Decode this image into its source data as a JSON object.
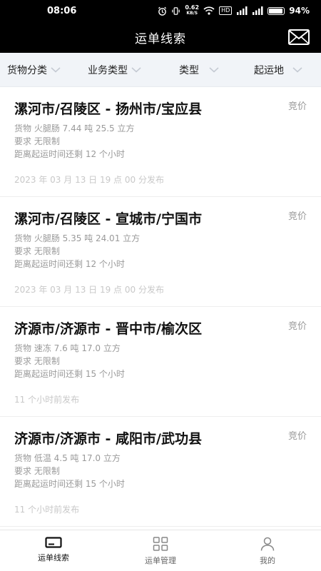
{
  "status_bar": {
    "time": "08:06",
    "net_speed_value": "0.62",
    "net_speed_unit": "KB/S",
    "hd": "HD",
    "battery": "94%",
    "battery_level": 0.94
  },
  "header": {
    "title": "运单线索"
  },
  "filters": [
    {
      "label": "货物分类"
    },
    {
      "label": "业务类型"
    },
    {
      "label": "类型"
    },
    {
      "label": "起运地"
    }
  ],
  "items": [
    {
      "route": "漯河市/召陵区 - 扬州市/宝应县",
      "quote": "竞价",
      "cargo": "货物 火腿肠 7.44 吨 25.5 立方",
      "requirement": "要求 无限制",
      "remaining": "距离起运时间还剩 12 个小时",
      "published": "2023 年 03 月 13 日 19 点 00 分发布"
    },
    {
      "route": "漯河市/召陵区 - 宣城市/宁国市",
      "quote": "竞价",
      "cargo": "货物 火腿肠 5.35 吨 24.01 立方",
      "requirement": "要求 无限制",
      "remaining": "距离起运时间还剩 12 个小时",
      "published": "2023 年 03 月 13 日 19 点 00 分发布"
    },
    {
      "route": "济源市/济源市 - 晋中市/榆次区",
      "quote": "竞价",
      "cargo": "货物 速冻 7.6 吨 17.0 立方",
      "requirement": "要求 无限制",
      "remaining": "距离起运时间还剩 15 个小时",
      "published": "11 个小时前发布"
    },
    {
      "route": "济源市/济源市 - 咸阳市/武功县",
      "quote": "竞价",
      "cargo": "货物 低温 4.5 吨 17.0 立方",
      "requirement": "要求 无限制",
      "remaining": "距离起运时间还剩 15 个小时",
      "published": "11 个小时前发布"
    }
  ],
  "bottom_nav": [
    {
      "label": "运单线索",
      "icon": "waybill-icon",
      "active": true
    },
    {
      "label": "运单管理",
      "icon": "grid-icon",
      "active": false
    },
    {
      "label": "我的",
      "icon": "user-icon",
      "active": false
    }
  ],
  "colors": {
    "header_bg": "#000000",
    "filter_bg": "#f1f4f8",
    "muted_text": "#9a9a9a",
    "faint_text": "#c8c8c8"
  }
}
